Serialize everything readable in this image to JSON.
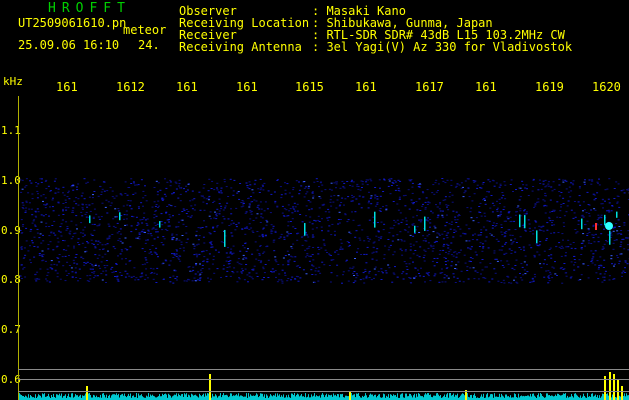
{
  "header": {
    "app_name": "HROFFT",
    "file_name": "UT2509061610.pn",
    "tag": "meteor",
    "datetime": "25.09.06 16:10",
    "count": "24."
  },
  "info": [
    {
      "label": "Observer",
      "value": ": Masaki Kano"
    },
    {
      "label": "Receiving Location",
      "value": ": Shibukawa, Gunma, Japan"
    },
    {
      "label": "Receiver",
      "value": ": RTL-SDR SDR# 43dB L15 103.2MHz CW"
    },
    {
      "label": "Receiving Antenna",
      "value": ": 3el Yagi(V) Az 330 for Vladivostok"
    }
  ],
  "axis": {
    "unit": "kHz",
    "y_ticks": [
      "1.1",
      "1.0",
      "0.9",
      "0.8",
      "0.7",
      "0.6"
    ],
    "x_ticks": [
      "161",
      "1612",
      "161",
      "161",
      "1615",
      "161",
      "1617",
      "161",
      "1619",
      "1620"
    ]
  },
  "colors": {
    "label": "#ffff00",
    "title": "#00d000",
    "noise_band": "#1018c8",
    "meteor_echo": "#00e0e0",
    "level_bars": "#ffff00",
    "level_base": "#00c8d0"
  }
}
